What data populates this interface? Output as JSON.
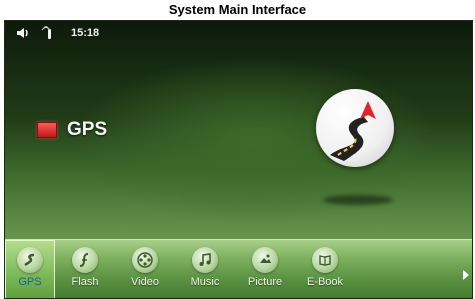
{
  "caption": "System Main Interface",
  "status_bar": {
    "time": "15:18",
    "icons": [
      "volume-icon",
      "antenna-icon"
    ]
  },
  "main": {
    "title": "GPS",
    "emblem": "gps-navigation-icon",
    "colors": {
      "title_square": "#d42020",
      "emblem_arrow": "#e0252a",
      "road": "#222222"
    }
  },
  "dock": {
    "active_index": 0,
    "items": [
      {
        "label": "GPS",
        "icon": "gps-icon"
      },
      {
        "label": "Flash",
        "icon": "flash-icon"
      },
      {
        "label": "Video",
        "icon": "video-icon"
      },
      {
        "label": "Music",
        "icon": "music-icon"
      },
      {
        "label": "Picture",
        "icon": "picture-icon"
      },
      {
        "label": "E-Book",
        "icon": "ebook-icon"
      }
    ],
    "next_icon": "chevron-right-icon"
  }
}
